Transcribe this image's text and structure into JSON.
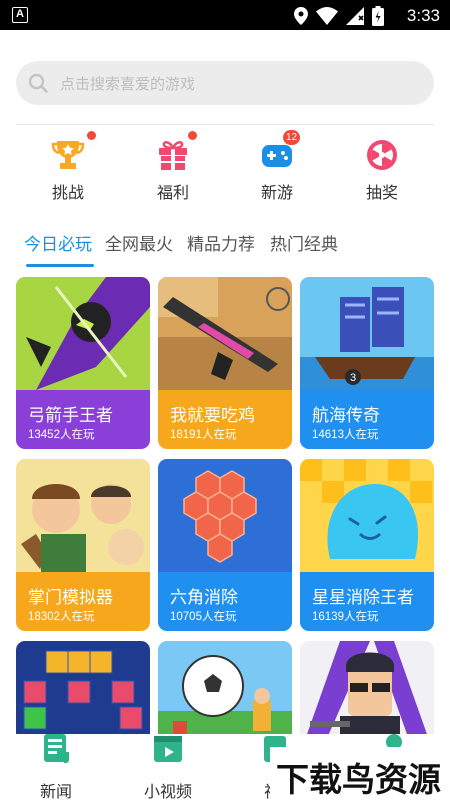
{
  "status_bar": {
    "time": "3:33",
    "app_icon_letter": "A"
  },
  "search": {
    "placeholder": "点击搜索喜爱的游戏"
  },
  "quick_entries": [
    {
      "label": "挑战",
      "icon": "trophy-icon",
      "badge": "dot"
    },
    {
      "label": "福利",
      "icon": "gift-icon",
      "badge": "dot"
    },
    {
      "label": "新游",
      "icon": "gamepad-icon",
      "badge": "12"
    },
    {
      "label": "抽奖",
      "icon": "lucky-wheel-icon",
      "badge": ""
    }
  ],
  "tabs": [
    {
      "label": "今日必玩",
      "active": true
    },
    {
      "label": "全网最火",
      "active": false
    },
    {
      "label": "精品力荐",
      "active": false
    },
    {
      "label": "热门经典",
      "active": false
    }
  ],
  "games": [
    {
      "title": "弓箭手王者",
      "players": "13452人在玩",
      "color": "#8b3fd9"
    },
    {
      "title": "我就要吃鸡",
      "players": "18191人在玩",
      "color": "#f7a71b"
    },
    {
      "title": "航海传奇",
      "players": "14613人在玩",
      "color": "#1f8ff0"
    },
    {
      "title": "掌门模拟器",
      "players": "18302人在玩",
      "color": "#f7a71b"
    },
    {
      "title": "六角消除",
      "players": "10705人在玩",
      "color": "#1f8ff0"
    },
    {
      "title": "星星消除王者",
      "players": "16139人在玩",
      "color": "#1f8ff0"
    },
    {
      "title": "",
      "players": "",
      "color": "#1f8ff0"
    },
    {
      "title": "",
      "players": "",
      "color": "#1f8ff0"
    },
    {
      "title": "",
      "players": "",
      "color": "#8b3fd9"
    }
  ],
  "bottom_nav": [
    {
      "label": "新闻",
      "icon": "news-icon"
    },
    {
      "label": "小视频",
      "icon": "video-icon"
    },
    {
      "label": "视",
      "icon": "tv-icon"
    }
  ],
  "watermark": {
    "text": "下载鸟资源"
  },
  "colors": {
    "accent": "#1a8fe8",
    "badge_red": "#f24a39",
    "search_bg": "#ececec"
  }
}
